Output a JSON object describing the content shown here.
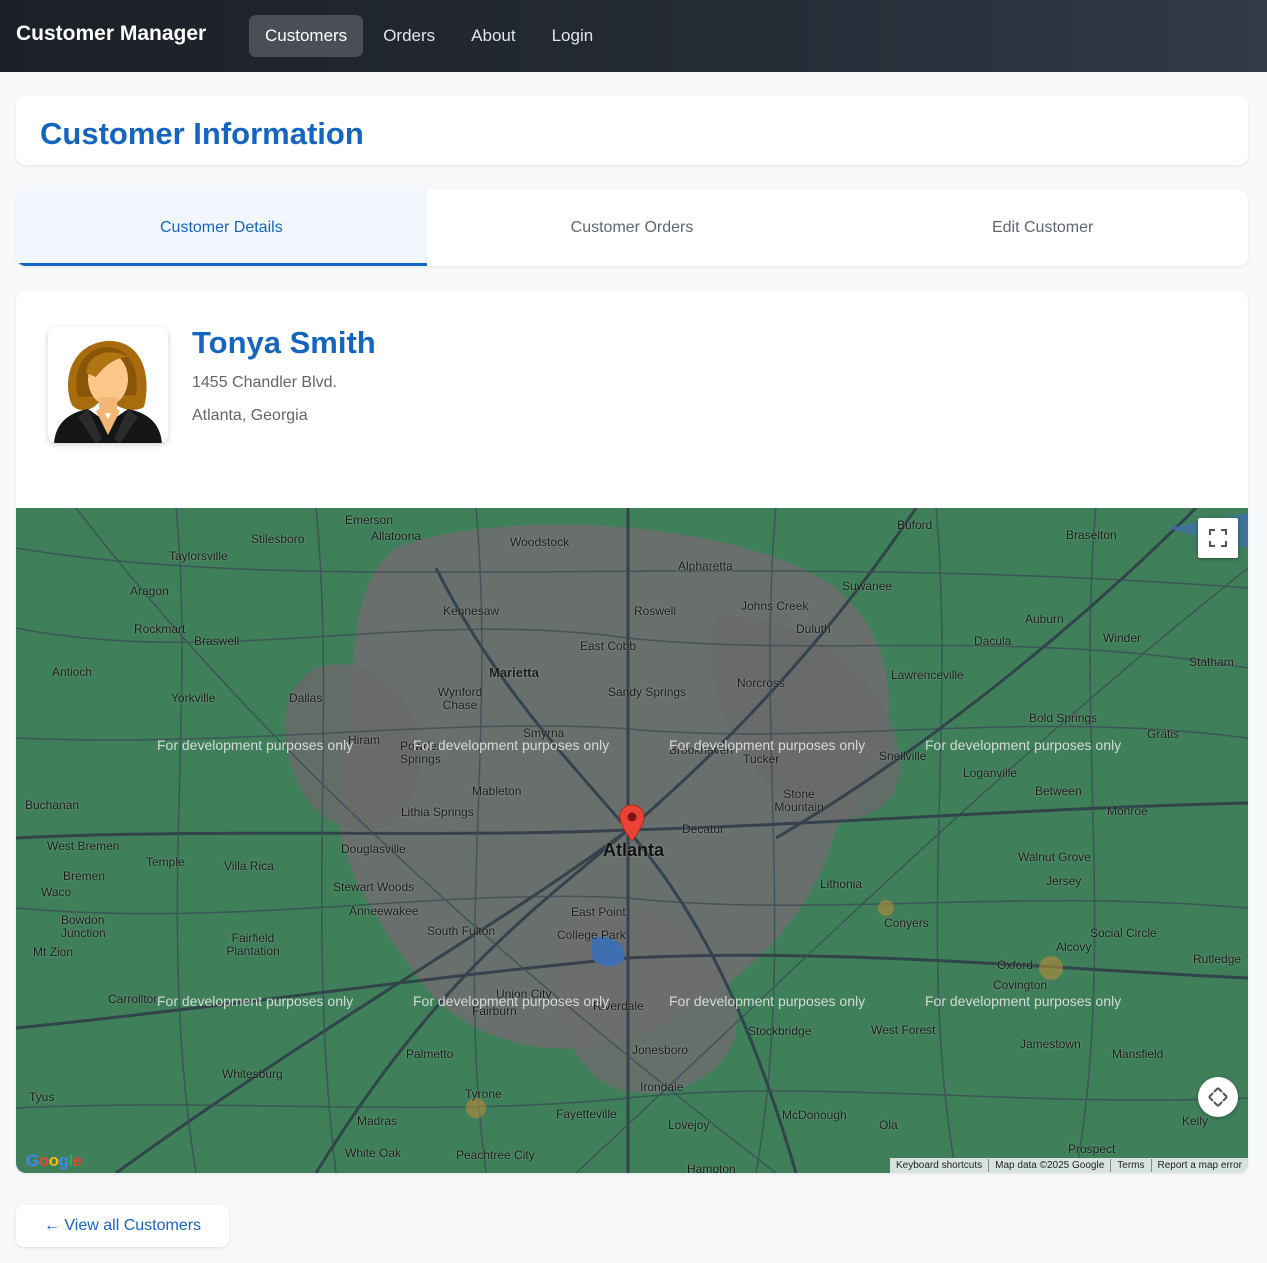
{
  "navbar": {
    "brand": "Customer Manager",
    "items": [
      {
        "label": "Customers",
        "active": true
      },
      {
        "label": "Orders",
        "active": false
      },
      {
        "label": "About",
        "active": false
      },
      {
        "label": "Login",
        "active": false
      }
    ]
  },
  "page": {
    "title": "Customer Information"
  },
  "tabs": [
    {
      "label": "Customer Details",
      "active": true
    },
    {
      "label": "Customer Orders",
      "active": false
    },
    {
      "label": "Edit Customer",
      "active": false
    }
  ],
  "customer": {
    "name": "Tonya Smith",
    "address": "1455 Chandler Blvd.",
    "city_state": "Atlanta, Georgia",
    "avatar_icon": "female-avatar-icon"
  },
  "map": {
    "center_label": "Atlanta",
    "watermark": "For development purposes only",
    "labels": [
      "Emerson",
      "Stilesboro",
      "Allatoona",
      "Woodstock",
      "Alpharetta",
      "Buford",
      "Braselton",
      "Taylorsville",
      "Aragon",
      "Kennesaw",
      "Roswell",
      "Johns Creek",
      "Suwanee",
      "Auburn",
      "Rockmart",
      "Braswell",
      "East Cobb",
      "Duluth",
      "Dacula",
      "Winder",
      "Statham",
      "Antioch",
      "Marietta",
      "Sandy Springs",
      "Norcross",
      "Lawrenceville",
      "Yorkville",
      "Dallas",
      "Wynford Chase",
      "Bold Springs",
      "Hiram",
      "Smyrna",
      "Powder Springs",
      "Brookhaven",
      "Tucker",
      "Snellville",
      "Loganville",
      "Gratis",
      "Mableton",
      "Lithia Springs",
      "Stone Mountain",
      "Between",
      "Buchanan",
      "Decatur",
      "Monroe",
      "West Bremen",
      "Douglasville",
      "Temple",
      "Villa Rica",
      "Bremen",
      "Walnut Grove",
      "Waco",
      "Stewart Woods",
      "Lithonia",
      "Jersey",
      "Anneewakee",
      "East Point",
      "Bowdon Junction",
      "South Fulton",
      "College Park",
      "Conyers",
      "Social Circle",
      "Fairfield Plantation",
      "Mt Zion",
      "Alcovy",
      "Rutledge",
      "Oxford",
      "Covington",
      "Carrollton",
      "Union City",
      "Fairburn",
      "Riverdale",
      "West Forest",
      "Stockbridge",
      "Jamestown",
      "Mansfield",
      "Palmetto",
      "Jonesboro",
      "Whitesburg",
      "Irondale",
      "Tyrone",
      "Tyus",
      "Fayetteville",
      "McDonough",
      "Madras",
      "Lovejoy",
      "Ola",
      "White Oak",
      "Peachtree City",
      "Hampton",
      "Prospect",
      "Kelly"
    ],
    "attribution": [
      "Keyboard shortcuts",
      "Map data ©2025 Google",
      "Terms",
      "Report a map error"
    ],
    "logo_text": "Google",
    "fullscreen_icon": "fullscreen-icon",
    "pan_icon": "pan-control-icon",
    "marker_icon": "map-pin-icon"
  },
  "back_button": {
    "label": "← View all Customers"
  }
}
